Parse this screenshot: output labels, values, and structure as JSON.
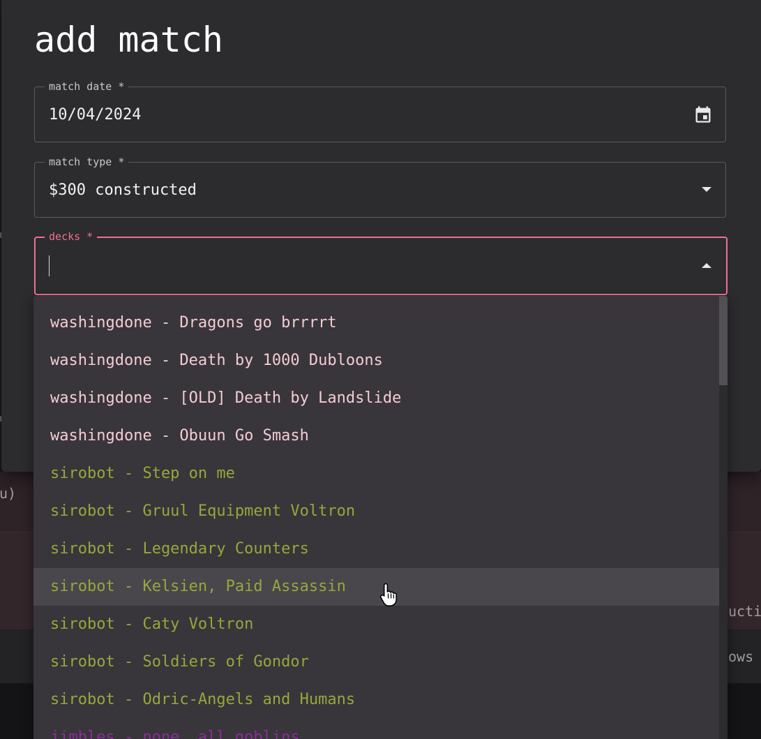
{
  "background": {
    "fragment_1": "u)",
    "fragment_2": "ucti",
    "fragment_3": "ows"
  },
  "dialog": {
    "title": "add match",
    "match_date": {
      "label": "match date *",
      "value": "10/04/2024",
      "icon": "calendar-icon"
    },
    "match_type": {
      "label": "match type *",
      "value": "$300 constructed",
      "icon": "chevron-down-icon"
    },
    "decks": {
      "label": "decks *",
      "value": "",
      "icon": "chevron-up-icon"
    }
  },
  "dropdown": {
    "hovered_index": 7,
    "options": [
      {
        "label": "washingdone - Dragons go brrrrt",
        "color": "#f6cbd4"
      },
      {
        "label": "washingdone - Death by 1000 Dubloons",
        "color": "#f6cbd4"
      },
      {
        "label": "washingdone - [OLD] Death by Landslide",
        "color": "#f6cbd4"
      },
      {
        "label": "washingdone - Obuun Go Smash",
        "color": "#f6cbd4"
      },
      {
        "label": "sirobot - Step on me",
        "color": "#9aa63c"
      },
      {
        "label": "sirobot - Gruul Equipment Voltron",
        "color": "#9aa63c"
      },
      {
        "label": "sirobot - Legendary Counters",
        "color": "#9aa63c"
      },
      {
        "label": "sirobot - Kelsien, Paid Assassin",
        "color": "#9aa63c"
      },
      {
        "label": "sirobot - Caty Voltron",
        "color": "#9aa63c"
      },
      {
        "label": "sirobot - Soldiers of Gondor",
        "color": "#9aa63c"
      },
      {
        "label": "sirobot - Odric-Angels and Humans",
        "color": "#9aa63c"
      },
      {
        "label": "jimbles - none, all goblins",
        "color": "#8b2c9b"
      }
    ]
  },
  "colors": {
    "accent": "#ee7192",
    "dialog_bg": "#2c2b2e",
    "dropdown_bg": "#38363a"
  }
}
